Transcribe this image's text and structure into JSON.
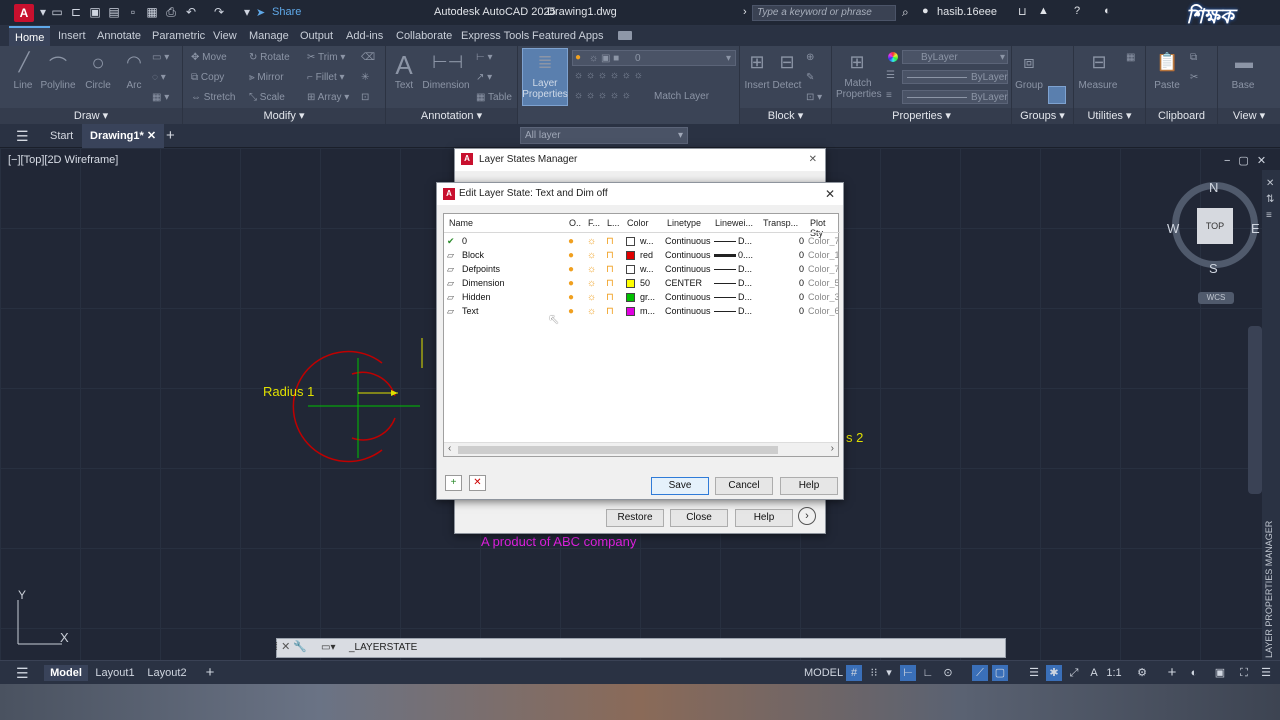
{
  "titlebar": {
    "app_title": "Autodesk AutoCAD 2025",
    "file": "Drawing1.dwg",
    "share": "Share",
    "search_placeholder": "Type a keyword or phrase",
    "user": "hasib.16eee",
    "app_letter": "A"
  },
  "tabs": [
    "Home",
    "Insert",
    "Annotate",
    "Parametric",
    "View",
    "Manage",
    "Output",
    "Add-ins",
    "Collaborate",
    "Express Tools",
    "Featured Apps"
  ],
  "ribbon": {
    "draw": {
      "title": "Draw",
      "tools": [
        "Line",
        "Polyline",
        "Circle",
        "Arc"
      ]
    },
    "modify": {
      "title": "Modify",
      "tools": [
        "Move",
        "Rotate",
        "Trim",
        "Copy",
        "Mirror",
        "Fillet",
        "Stretch",
        "Scale",
        "Array"
      ]
    },
    "annotation": {
      "title": "Annotation",
      "tools": [
        "Text",
        "Dimension",
        "Table"
      ]
    },
    "layers": {
      "tool": "Layer Properties",
      "current": "0",
      "match": "Match Layer",
      "dropdown": "All layer"
    },
    "block": {
      "title": "Block",
      "tools": [
        "Insert",
        "Detect"
      ]
    },
    "properties": {
      "title": "Properties",
      "tool": "Match Properties",
      "bylayer": "ByLayer"
    },
    "groups": {
      "title": "Groups",
      "tool": "Group"
    },
    "utilities": {
      "title": "Utilities",
      "tool": "Measure"
    },
    "clipboard": {
      "title": "Clipboard",
      "tool": "Paste"
    },
    "view": {
      "title": "View",
      "tool": "Base"
    }
  },
  "filetabs": {
    "start": "Start",
    "drawing": "Drawing1*"
  },
  "viewport": {
    "label": "[−][Top][2D Wireframe]",
    "radius1": "Radius 1",
    "radius2_fragment": "s 2",
    "product_text": "A product of ABC company"
  },
  "viewcube": {
    "n": "N",
    "s": "S",
    "e": "E",
    "w": "W",
    "top": "TOP",
    "wcs": "WCS"
  },
  "ucs": {
    "y": "Y",
    "x": "X"
  },
  "side_panel": "LAYER PROPERTIES MANAGER",
  "command": {
    "text": "_LAYERSTATE"
  },
  "layer_states_manager": {
    "title": "Layer States Manager",
    "buttons": [
      "Restore",
      "Close",
      "Help"
    ]
  },
  "edit_dialog": {
    "title": "Edit Layer State: Text and Dim off",
    "columns": [
      "Name",
      "O..",
      "F...",
      "L...",
      "Color",
      "Linetype",
      "Linewei...",
      "Transp...",
      "Plot Sty"
    ],
    "rows": [
      {
        "name": "0",
        "color": "w...",
        "swatch": "#ffffff",
        "linetype": "Continuous",
        "lw": "D...",
        "transp": "0",
        "plot": "Color_7",
        "current": true
      },
      {
        "name": "Block",
        "color": "red",
        "swatch": "#e00000",
        "linetype": "Continuous",
        "lw": "0....",
        "transp": "0",
        "plot": "Color_1",
        "current": false
      },
      {
        "name": "Defpoints",
        "color": "w...",
        "swatch": "#ffffff",
        "linetype": "Continuous",
        "lw": "D...",
        "transp": "0",
        "plot": "Color_7",
        "current": false
      },
      {
        "name": "Dimension",
        "color": "50",
        "swatch": "#ffff00",
        "linetype": "CENTER",
        "lw": "D...",
        "transp": "0",
        "plot": "Color_5",
        "current": false
      },
      {
        "name": "Hidden",
        "color": "gr...",
        "swatch": "#00c000",
        "linetype": "Continuous",
        "lw": "D...",
        "transp": "0",
        "plot": "Color_3",
        "current": false
      },
      {
        "name": "Text",
        "color": "m...",
        "swatch": "#e000e0",
        "linetype": "Continuous",
        "lw": "D...",
        "transp": "0",
        "plot": "Color_6",
        "current": false
      }
    ],
    "buttons": {
      "save": "Save",
      "cancel": "Cancel",
      "help": "Help"
    }
  },
  "layout_tabs": [
    "Model",
    "Layout1",
    "Layout2"
  ],
  "status": {
    "model": "MODEL",
    "scale": "1:1"
  },
  "colors": {
    "accent": "#5fa8e8",
    "radius": "#e0e000",
    "dim_green": "#00c000",
    "product": "#e020e0",
    "profile_red": "#c00000"
  }
}
